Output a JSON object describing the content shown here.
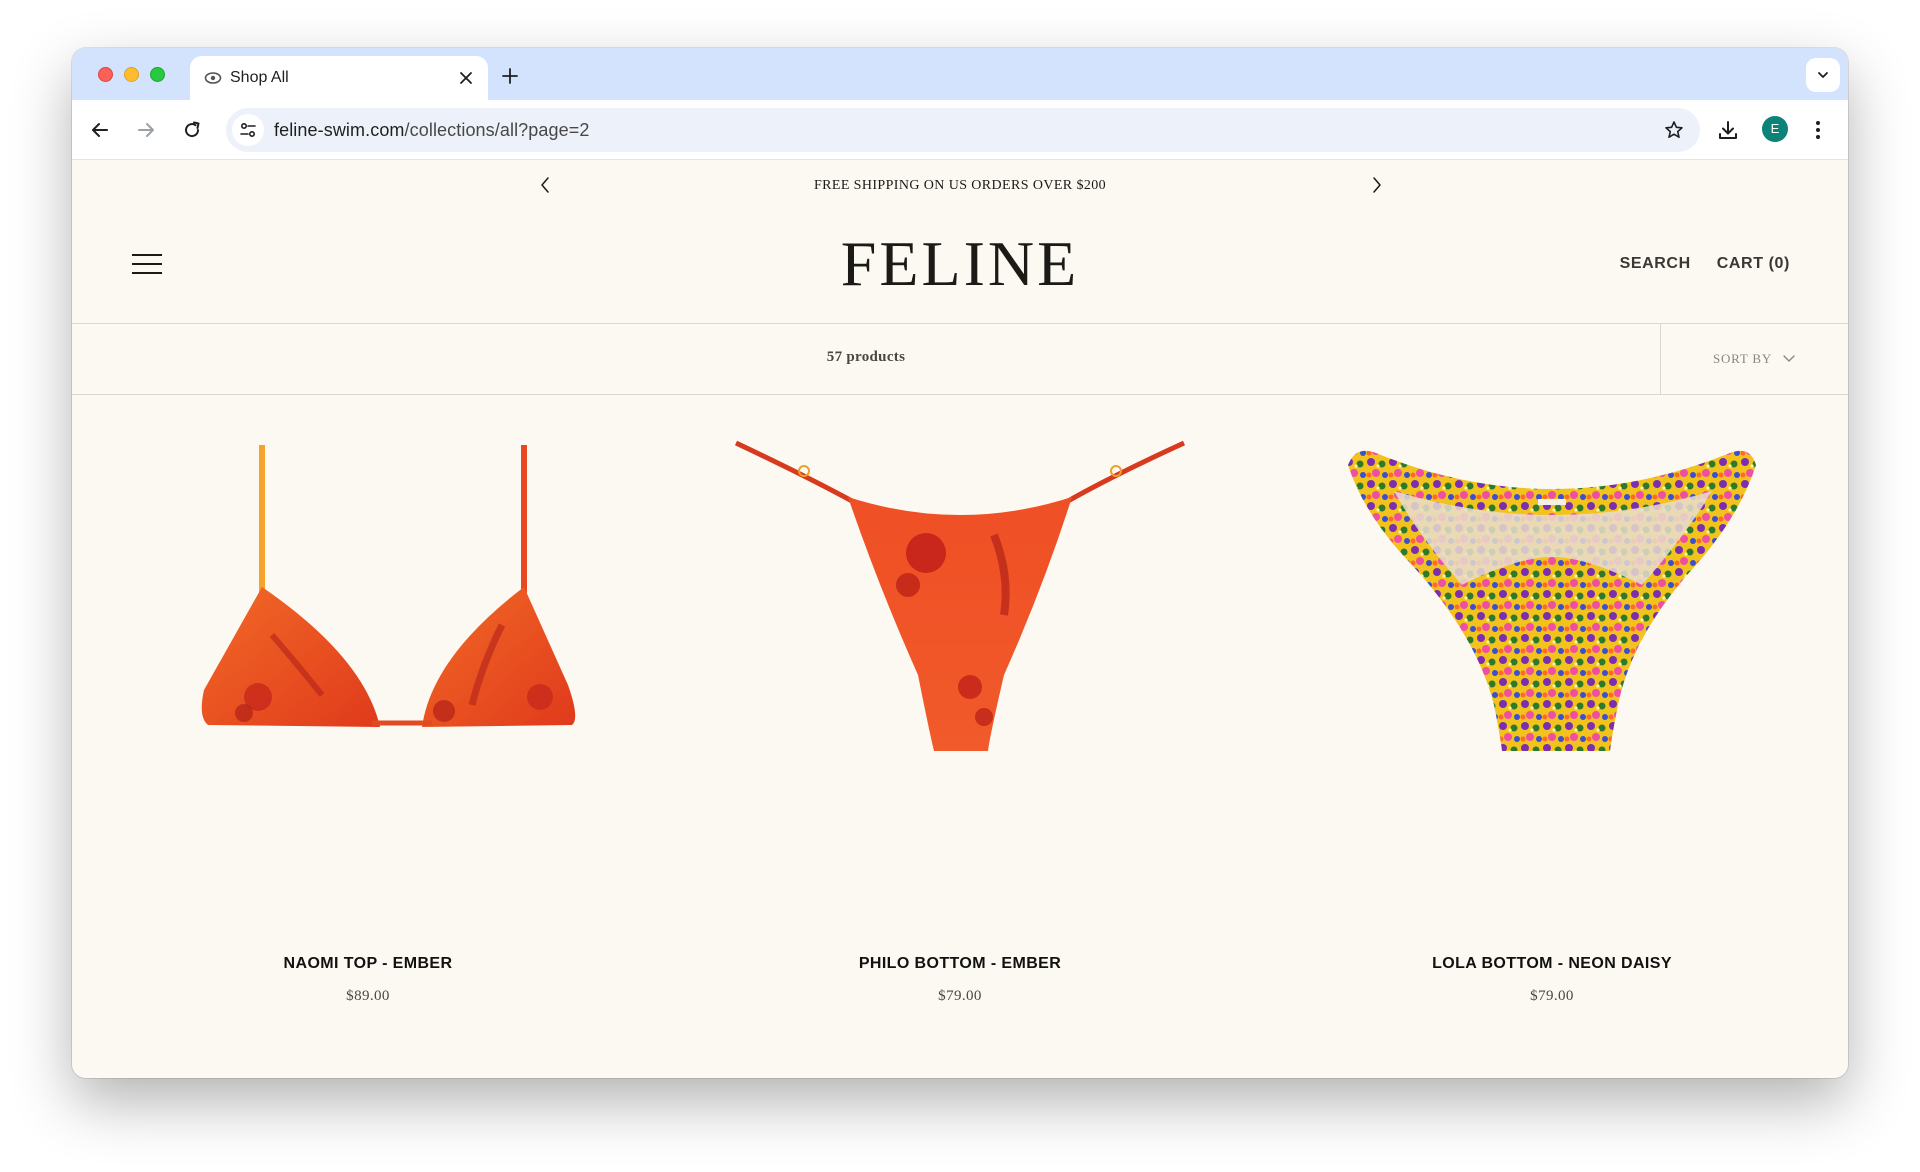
{
  "browser": {
    "tab": {
      "title": "Shop All",
      "favicon": "cat-eye-icon"
    },
    "url": {
      "host": "feline-swim.com",
      "path": "/collections/all?page=2"
    },
    "profile_initial": "E",
    "colors": {
      "tabstrip": "#d3e3fd",
      "omnibox": "#edf2fa",
      "avatar": "#0b8378"
    }
  },
  "announcement": {
    "text": "FREE SHIPPING ON US ORDERS OVER $200"
  },
  "header": {
    "logo": "FELINE",
    "search_label": "SEARCH",
    "cart_label": "CART (0)"
  },
  "collection": {
    "product_count": "57 products",
    "sort_label": "SORT BY"
  },
  "products": [
    {
      "name": "NAOMI TOP - EMBER",
      "price": "$89.00",
      "print": "ember-floral"
    },
    {
      "name": "PHILO BOTTOM - EMBER",
      "price": "$79.00",
      "print": "ember-floral"
    },
    {
      "name": "LOLA BOTTOM - NEON DAISY",
      "price": "$79.00",
      "print": "neon-daisy"
    }
  ],
  "colors": {
    "page_background": "#fcf9f3",
    "ember": "#e8411f",
    "text": "#1c1a17"
  }
}
